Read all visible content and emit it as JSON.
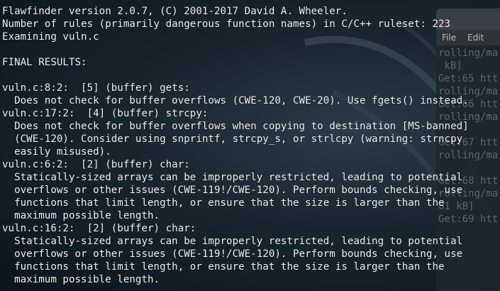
{
  "background_terminal": {
    "menu": [
      "File",
      "Edit"
    ],
    "lines": [
      "rolling/ma",
      " kB]",
      "Get:65 htt",
      "rolling/ma",
      "Get:66 htt",
      "rolling/ma",
      "",
      "Get:67 htt",
      "rolling/ma",
      "",
      "Get:68 htt",
      "rolling/ma",
      "81 kB]",
      "Get:69 htt"
    ]
  },
  "terminal": {
    "lines": [
      "Flawfinder version 2.0.7, (C) 2001-2017 David A. Wheeler.",
      "Number of rules (primarily dangerous function names) in C/C++ ruleset: 223",
      "Examining vuln.c",
      "",
      "FINAL RESULTS:",
      "",
      "vuln.c:8:2:  [5] (buffer) gets:",
      "  Does not check for buffer overflows (CWE-120, CWE-20). Use fgets() instead.",
      "vuln.c:17:2:  [4] (buffer) strcpy:",
      "  Does not check for buffer overflows when copying to destination [MS-banned]",
      "  (CWE-120). Consider using snprintf, strcpy_s, or strlcpy (warning: strncpy",
      "  easily misused).",
      "vuln.c:6:2:  [2] (buffer) char:",
      "  Statically-sized arrays can be improperly restricted, leading to potential",
      "  overflows or other issues (CWE-119!/CWE-120). Perform bounds checking, use",
      "  functions that limit length, or ensure that the size is larger than the",
      "  maximum possible length.",
      "vuln.c:16:2:  [2] (buffer) char:",
      "  Statically-sized arrays can be improperly restricted, leading to potential",
      "  overflows or other issues (CWE-119!/CWE-120). Perform bounds checking, use",
      "  functions that limit length, or ensure that the size is larger than the",
      "  maximum possible length."
    ]
  }
}
